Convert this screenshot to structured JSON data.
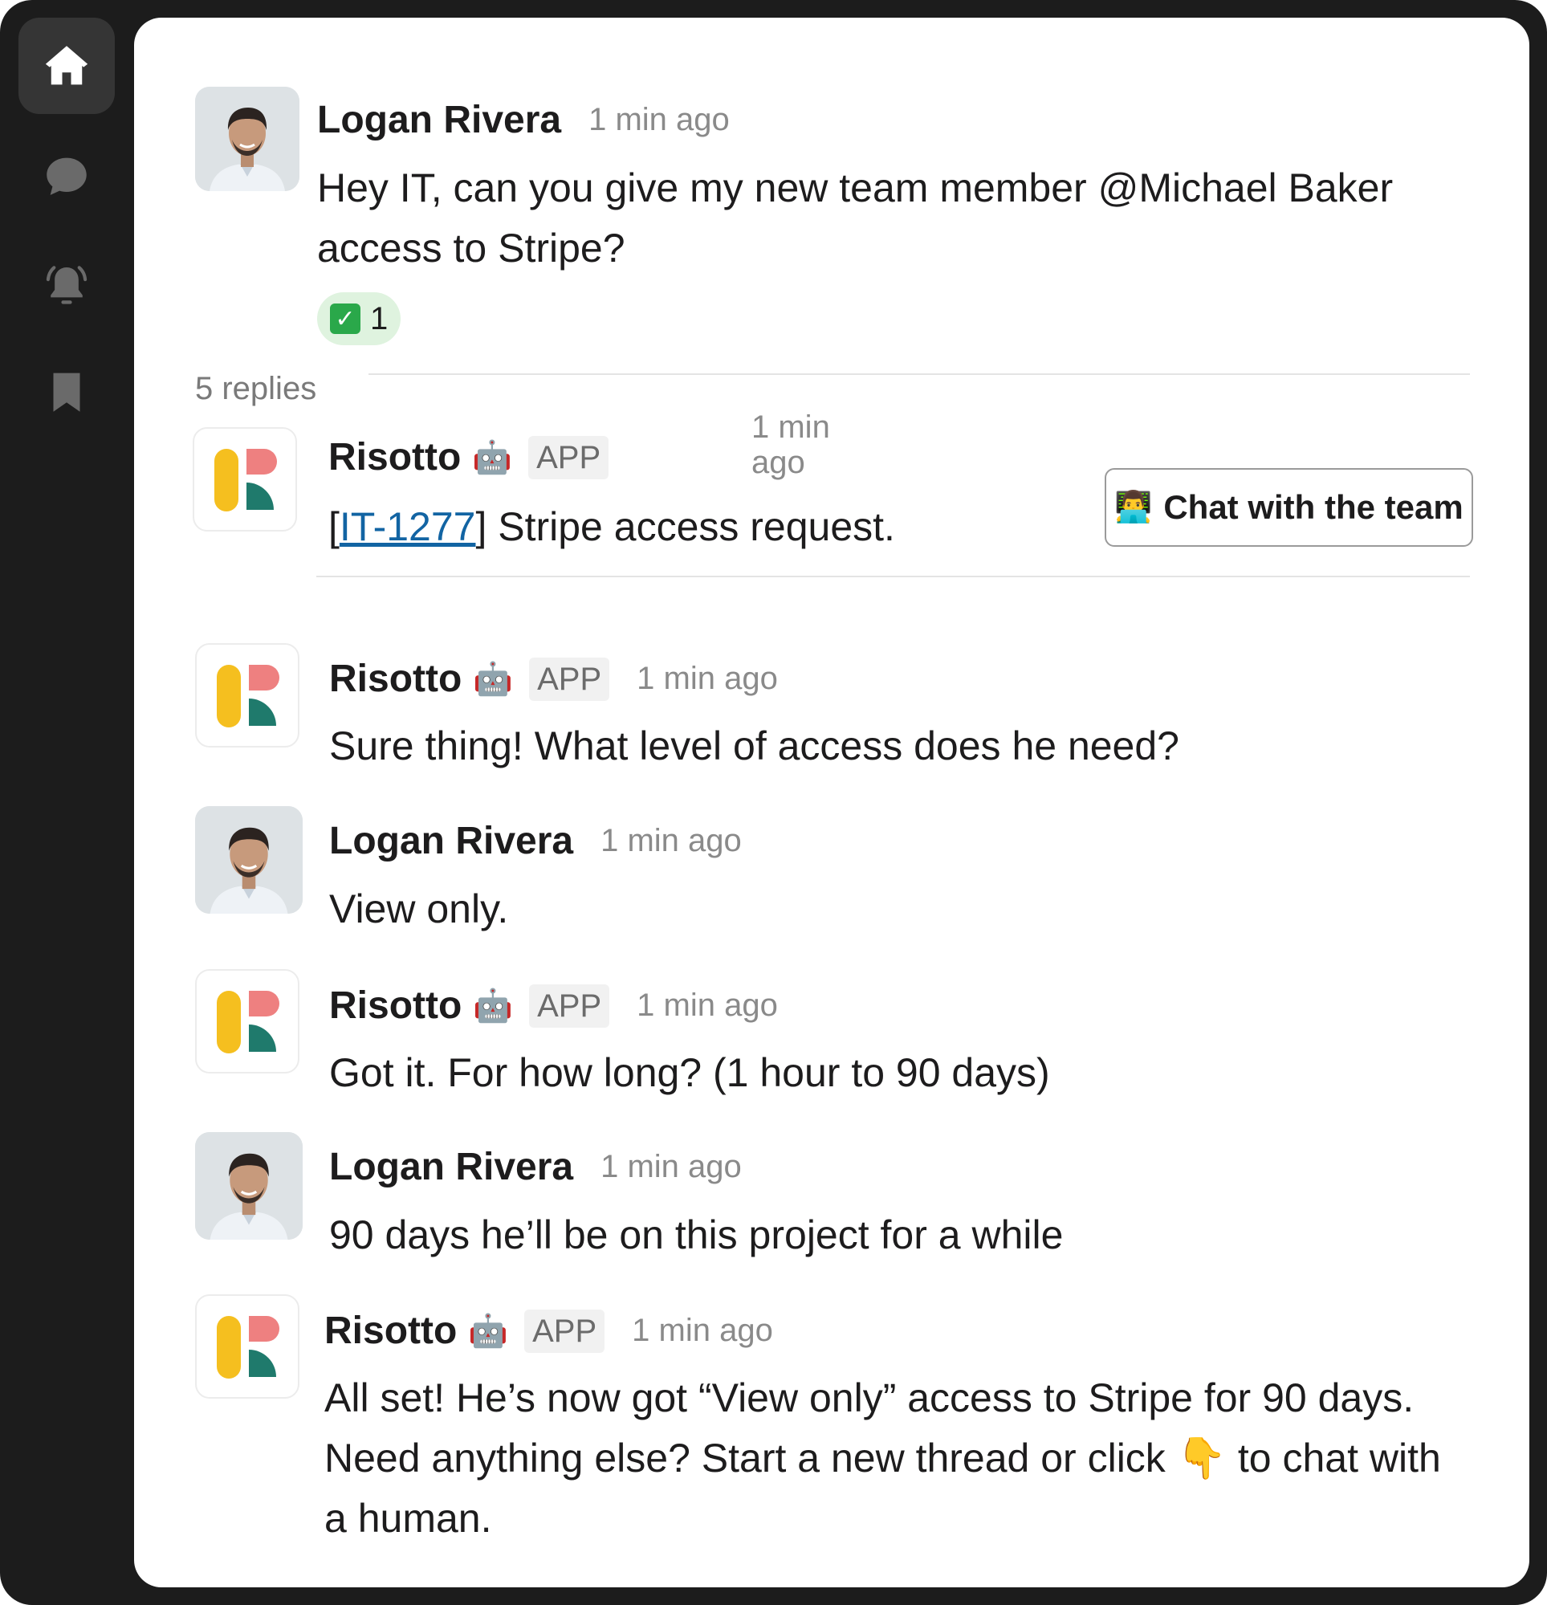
{
  "sidebar": {
    "items": [
      {
        "icon": "home-icon",
        "active": true
      },
      {
        "icon": "chat-bubble-icon",
        "active": false
      },
      {
        "icon": "notification-bell-icon",
        "active": false
      },
      {
        "icon": "bookmark-icon",
        "active": false
      }
    ]
  },
  "thread": {
    "parent": {
      "author": "Logan Rivera",
      "time": "1 min ago",
      "text_line1": "Hey IT, can you give my new team member @Michael Baker",
      "text_line2": "access to Stripe?",
      "reaction": {
        "emoji": "✓",
        "count": "1"
      }
    },
    "replies_label": "5 replies",
    "ticket": {
      "author": "Risotto",
      "robot": "🤖",
      "badge": "APP",
      "time": "1 min ago",
      "open_bracket": "[",
      "ticket_id": "IT-1277",
      "rest": "] Stripe access request.",
      "button": {
        "emoji": "👨‍💻",
        "label": "Chat with the team"
      }
    },
    "replies": [
      {
        "author": "Risotto",
        "robot": "🤖",
        "badge": "APP",
        "time": "1 min ago",
        "text": "Sure thing! What level of access does he need?"
      },
      {
        "author": "Logan Rivera",
        "time": "1 min ago",
        "text": "View only."
      },
      {
        "author": "Risotto",
        "robot": "🤖",
        "badge": "APP",
        "time": "1 min ago",
        "text": "Got it. For how long? (1 hour to 90 days)"
      },
      {
        "author": "Logan Rivera",
        "time": "1 min ago",
        "text": "90 days he’ll be on this project for a while"
      },
      {
        "author": "Risotto",
        "robot": "🤖",
        "badge": "APP",
        "time": "1 min ago",
        "text_line1": "All set! He’s now got “View only” access to Stripe for 90 days.",
        "text_line2_a": "Need anything else? Start a new thread or click ",
        "pointer": "👇",
        "text_line2_b": " to chat with",
        "text_line3": "a human."
      }
    ]
  },
  "colors": {
    "logo_yellow": "#f5bf1f",
    "logo_pink": "#ee8080",
    "logo_teal": "#1f7a6c",
    "link": "#1264a3",
    "reaction_bg": "#dff3df"
  }
}
